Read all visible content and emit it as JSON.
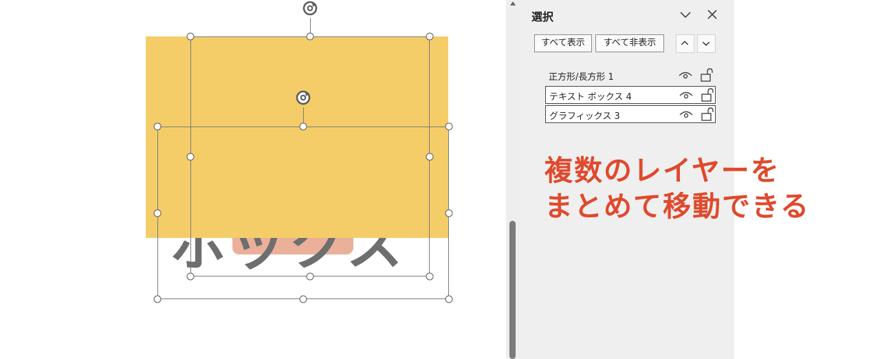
{
  "canvas": {
    "text_box_text": "ボックス"
  },
  "selection_pane": {
    "title": "選択",
    "show_all_label": "すべて表示",
    "hide_all_label": "すべて非表示",
    "layers": [
      {
        "label": "正方形/長方形 1",
        "selected": false
      },
      {
        "label": "テキスト ボックス 4",
        "selected": true
      },
      {
        "label": "グラフィックス 3",
        "selected": true
      }
    ]
  },
  "annotation": {
    "line1": "複数のレイヤーを",
    "line2": "まとめて移動できる"
  },
  "colors": {
    "annotation": "#e0492c",
    "rectangle_fill": "#f4cd69",
    "pill_fill": "#eab09a",
    "text_fill": "#6e6e6e"
  }
}
